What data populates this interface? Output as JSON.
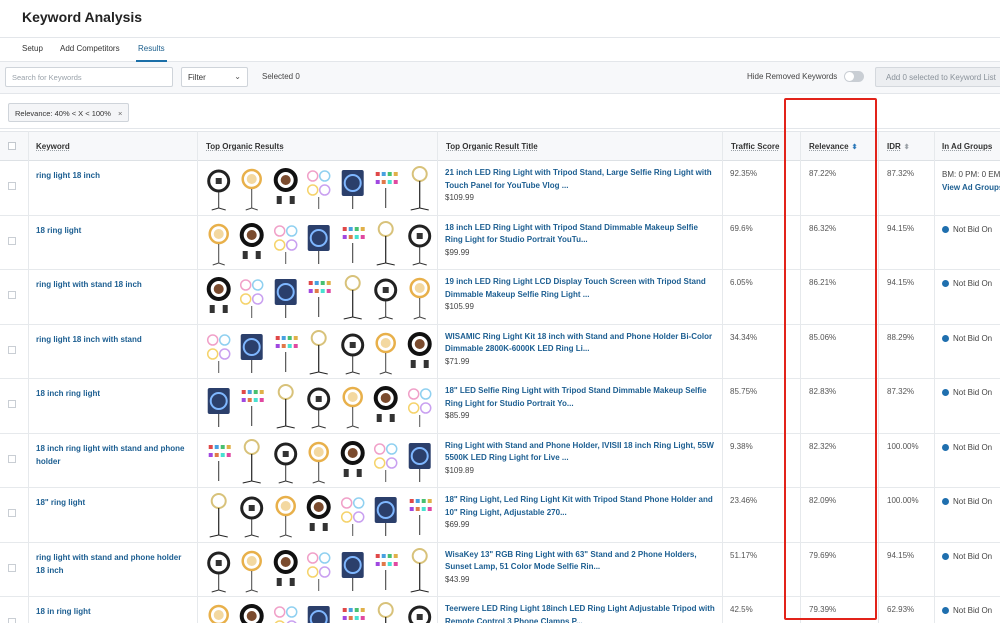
{
  "page": {
    "title": "Keyword Analysis"
  },
  "tabs": [
    {
      "label": "Setup"
    },
    {
      "label": "Add Competitors"
    },
    {
      "label": "Results",
      "active": true
    }
  ],
  "toolbar": {
    "search_placeholder": "Search for Keywords",
    "filter_label": "Filter",
    "selected_text": "Selected 0",
    "hide_removed_label": "Hide Removed Keywords",
    "hide_removed_on": false,
    "add_button_label": "Add 0 selected to Keyword List"
  },
  "active_filter": {
    "label": "Relevance: 40% < X < 100%",
    "remove_glyph": "×"
  },
  "columns": {
    "keyword": "Keyword",
    "top_results": "Top Organic Results",
    "top_title": "Top Organic Result Title",
    "traffic": "Traffic Score",
    "relevance": "Relevance",
    "idr": "IDR",
    "ad_groups": "In Ad Groups"
  },
  "colors": {
    "link": "#1c5e91",
    "highlight": "#e2231a",
    "status_dot": "#1f6fae"
  },
  "rows": [
    {
      "keyword": "ring light 18 inch",
      "title": "21 inch LED Ring Light with Tripod Stand, Large Selfie Ring Light with Touch Panel for YouTube Vlog ...",
      "price": "$109.99",
      "traffic": "92.35%",
      "relevance": "87.22%",
      "idr": "87.32%",
      "ad_status": "BM: 0 PM: 0 EM",
      "ad_link": "View Ad Groups"
    },
    {
      "keyword": "18 ring light",
      "title": "18 inch LED Ring Light with Tripod Stand Dimmable Makeup Selfie Ring Light for Studio Portrait YouTu...",
      "price": "$99.99",
      "traffic": "69.6%",
      "relevance": "86.32%",
      "idr": "94.15%",
      "ad_status": "Not Bid On"
    },
    {
      "keyword": "ring light with stand 18 inch",
      "title": "19 inch LED Ring Light LCD Display Touch Screen with Tripod Stand Dimmable Makeup Selfie Ring Light ...",
      "price": "$105.99",
      "traffic": "6.05%",
      "relevance": "86.21%",
      "idr": "94.15%",
      "ad_status": "Not Bid On"
    },
    {
      "keyword": "ring light 18 inch with stand",
      "title": "WISAMIC Ring Light Kit 18 inch with Stand and Phone Holder Bi-Color Dimmable 2800K-6000K LED Ring Li...",
      "price": "$71.99",
      "traffic": "34.34%",
      "relevance": "85.06%",
      "idr": "88.29%",
      "ad_status": "Not Bid On"
    },
    {
      "keyword": "18 inch ring light",
      "title": "18\" LED Selfie Ring Light with Tripod Stand Dimmable Makeup Selfie Ring Light for Studio Portrait Yo...",
      "price": "$85.99",
      "traffic": "85.75%",
      "relevance": "82.83%",
      "idr": "87.32%",
      "ad_status": "Not Bid On"
    },
    {
      "keyword": "18 inch ring light with stand and phone holder",
      "title": "Ring Light with Stand and Phone Holder, IVISII 18 inch Ring Light, 55W 5500K LED Ring Light for Live ...",
      "price": "$109.89",
      "traffic": "9.38%",
      "relevance": "82.32%",
      "idr": "100.00%",
      "ad_status": "Not Bid On"
    },
    {
      "keyword": "18\" ring light",
      "title": "18\" Ring Light, Led Ring Light Kit with Tripod Stand Phone Holder and 10\" Ring Light, Adjustable 270...",
      "price": "$69.99",
      "traffic": "23.46%",
      "relevance": "82.09%",
      "idr": "100.00%",
      "ad_status": "Not Bid On"
    },
    {
      "keyword": "ring light with stand and phone holder 18 inch",
      "title": "WisaKey 13\" RGB Ring Light with 63\" Stand and 2 Phone Holders, Sunset Lamp, 51 Color Mode Selfie Rin...",
      "price": "$43.99",
      "traffic": "51.17%",
      "relevance": "79.69%",
      "idr": "94.15%",
      "ad_status": "Not Bid On"
    },
    {
      "keyword": "18 in ring light",
      "title": "Teerwere LED Ring Light 18inch LED Ring Light Adjustable Tripod with Remote Control 3 Phone Clamps P...",
      "price": "",
      "traffic": "42.5%",
      "relevance": "79.39%",
      "idr": "62.93%",
      "ad_status": "Not Bid On"
    }
  ]
}
